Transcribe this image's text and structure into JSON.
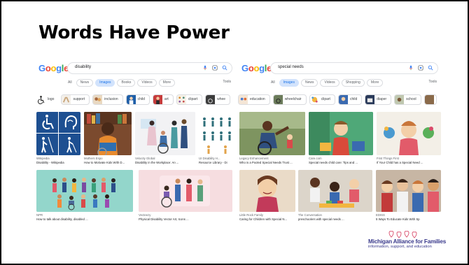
{
  "slide": {
    "title": "Words Have Power"
  },
  "left_search": {
    "query": "disability",
    "tabs": [
      "All",
      "News",
      "Images",
      "Books",
      "Videos",
      "More"
    ],
    "active_tab": "Images",
    "tools": "Tools",
    "chips": [
      "logo",
      "support",
      "inclusion",
      "child",
      "art",
      "clipart",
      "whee"
    ],
    "results": [
      {
        "source": "Wikipedia",
        "title": "Disability - Wikipedia"
      },
      {
        "source": "Mothers Espo",
        "title": "How to Motivate Kids With D..."
      },
      {
        "source": "Velocity Global",
        "title": "Disability in the Workplace: An ..."
      },
      {
        "source": "UI Disability H...",
        "title": "Resource Library - Di"
      },
      {
        "source": "NPR",
        "title": "How to talk about disability, disabled ..."
      },
      {
        "source": "Vecteezy",
        "title": "Physical Disability Vector Art, Icons ..."
      }
    ]
  },
  "right_search": {
    "query": "special needs",
    "tabs": [
      "All",
      "Images",
      "News",
      "Videos",
      "Shopping",
      "More"
    ],
    "active_tab": "Images",
    "tools": "Tools",
    "chips": [
      "education",
      "wheelchair",
      "clipart",
      "child",
      "diaper",
      "school",
      ""
    ],
    "results": [
      {
        "source": "Legacy Enhancement",
        "title": "Who is a Pooled Special Needs Trust ..."
      },
      {
        "source": "Care.com",
        "title": "Special needs child care: Tips and ..."
      },
      {
        "source": "First Things First",
        "title": "If Your Child has a Special Need ..."
      },
      {
        "source": "Little Rock Family",
        "title": "Caring for Children with Special N..."
      },
      {
        "source": "The Conversation",
        "title": "preschoolers with special needs ..."
      },
      {
        "source": "EDISS",
        "title": "5 Ways To Educate Kids With Sp"
      }
    ]
  },
  "org_logo": {
    "name": "Michigan Alliance for Families",
    "tagline": "information, support, and education"
  },
  "colors": {
    "google_blue": "#4285F4",
    "google_red": "#EA4335",
    "google_yellow": "#FBBC05",
    "google_green": "#34A853",
    "active_tab_bg": "#d2e3fc",
    "logo_purple": "#3a3a8c"
  },
  "icons": [
    "search-icon",
    "microphone-icon",
    "lens-icon",
    "accessibility-symbol-icon",
    "wheelchair-icon"
  ]
}
